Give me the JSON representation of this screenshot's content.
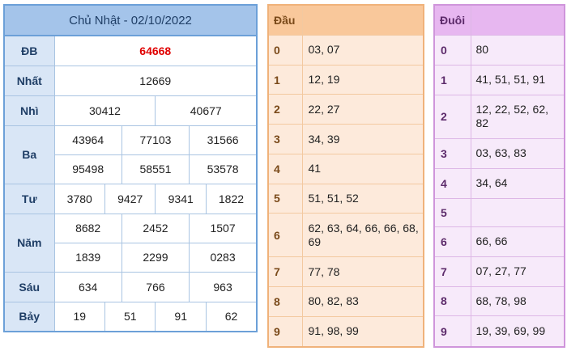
{
  "results": {
    "title": "Chủ Nhật - 02/10/2022",
    "labels": {
      "db": "ĐB",
      "nhat": "Nhất",
      "nhi": "Nhì",
      "ba": "Ba",
      "tu": "Tư",
      "nam": "Năm",
      "sau": "Sáu",
      "bay": "Bảy"
    },
    "db": "64668",
    "nhat": "12669",
    "nhi": [
      "30412",
      "40677"
    ],
    "ba": [
      "43964",
      "77103",
      "31566",
      "95498",
      "58551",
      "53578"
    ],
    "tu": [
      "3780",
      "9427",
      "9341",
      "1822"
    ],
    "nam": [
      "8682",
      "2452",
      "1507",
      "1839",
      "2299",
      "0283"
    ],
    "sau": [
      "634",
      "766",
      "963"
    ],
    "bay": [
      "19",
      "51",
      "91",
      "62"
    ],
    "colors": {
      "header_bg": "#a4c4ea",
      "special": "#e00000"
    }
  },
  "dau": {
    "header": "Đầu",
    "rows": [
      {
        "num": "0",
        "val": "03, 07"
      },
      {
        "num": "1",
        "val": "12, 19"
      },
      {
        "num": "2",
        "val": "22, 27"
      },
      {
        "num": "3",
        "val": "34, 39"
      },
      {
        "num": "4",
        "val": "41"
      },
      {
        "num": "5",
        "val": "51, 51, 52"
      },
      {
        "num": "6",
        "val": "62, 63, 64, 66, 66, 68, 69"
      },
      {
        "num": "7",
        "val": "77, 78"
      },
      {
        "num": "8",
        "val": "80, 82, 83"
      },
      {
        "num": "9",
        "val": "91, 98, 99"
      }
    ]
  },
  "duoi": {
    "header": "Đuôi",
    "rows": [
      {
        "num": "0",
        "val": "80"
      },
      {
        "num": "1",
        "val": "41, 51, 51, 91"
      },
      {
        "num": "2",
        "val": "12, 22, 52, 62, 82"
      },
      {
        "num": "3",
        "val": "03, 63, 83"
      },
      {
        "num": "4",
        "val": "34, 64"
      },
      {
        "num": "5",
        "val": ""
      },
      {
        "num": "6",
        "val": "66, 66"
      },
      {
        "num": "7",
        "val": "07, 27, 77"
      },
      {
        "num": "8",
        "val": "68, 78, 98"
      },
      {
        "num": "9",
        "val": "19, 39, 69, 99"
      }
    ]
  }
}
